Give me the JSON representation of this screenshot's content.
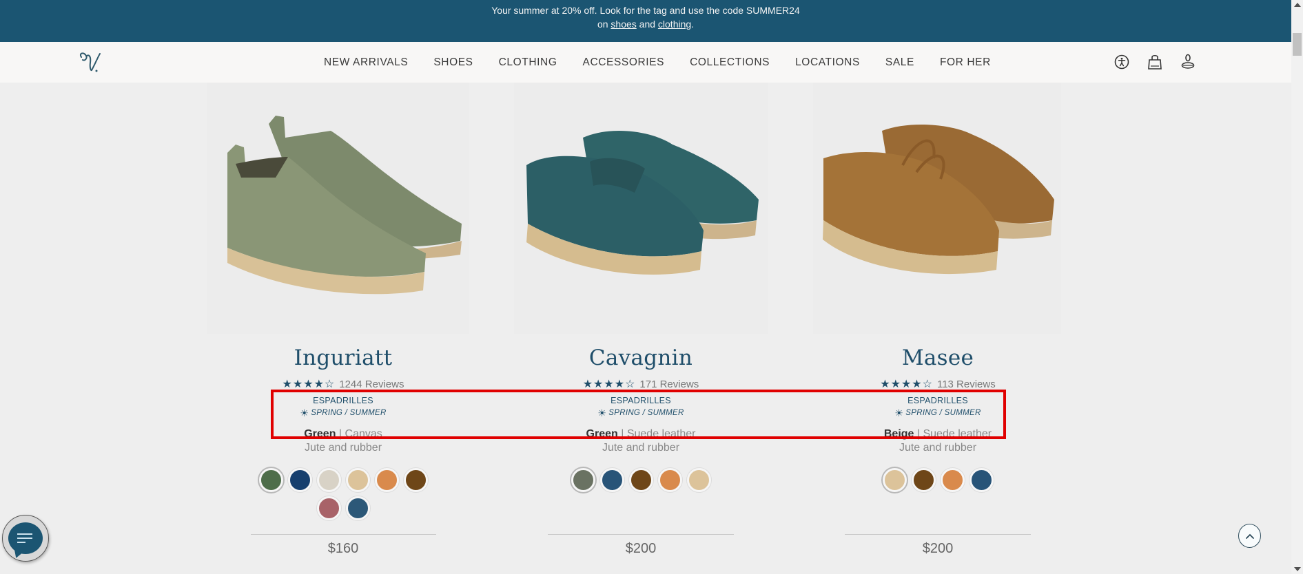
{
  "banner": {
    "line1": "Your summer at 20% off. Look for the tag and use the code SUMMER24",
    "line2_prefix": "on ",
    "link_shoes": "shoes",
    "line2_mid": " and ",
    "link_clothing": "clothing",
    "line2_suffix": "."
  },
  "header": {
    "logo_icon": "brand-monogram-logo",
    "nav": [
      {
        "label": "NEW ARRIVALS"
      },
      {
        "label": "SHOES"
      },
      {
        "label": "CLOTHING"
      },
      {
        "label": "ACCESSORIES"
      },
      {
        "label": "COLLECTIONS"
      },
      {
        "label": "LOCATIONS"
      },
      {
        "label": "SALE"
      },
      {
        "label": "FOR HER"
      }
    ],
    "icons": [
      "accessibility-icon",
      "shopping-bag-icon",
      "account-icon"
    ]
  },
  "products": [
    {
      "name": "Inguriatt",
      "stars": "★★★★☆",
      "rating": 4.5,
      "reviews": "1244 Reviews",
      "type": "ESPADRILLES",
      "season": "SPRING / SUMMER",
      "color": "Green",
      "material": "Canvas",
      "sole": "Jute and rubber",
      "swatches": [
        "#4e6e4a",
        "#163f6e",
        "#d8d2c6",
        "#dcc39a",
        "#d98a4c",
        "#6e4618",
        "#a86268",
        "#2c5878"
      ],
      "active_swatch": 0,
      "price": "$160"
    },
    {
      "name": "Cavagnin",
      "stars": "★★★★☆",
      "rating": 4.5,
      "reviews": "171 Reviews",
      "type": "ESPADRILLES",
      "season": "SPRING / SUMMER",
      "color": "Green",
      "material": "Suede leather",
      "sole": "Jute and rubber",
      "swatches": [
        "#6a7262",
        "#285478",
        "#6e4618",
        "#d98a4c",
        "#dcc39a"
      ],
      "active_swatch": 0,
      "price": "$200"
    },
    {
      "name": "Masee",
      "stars": "★★★★☆",
      "rating": 4.5,
      "reviews": "113 Reviews",
      "type": "ESPADRILLES",
      "season": "SPRING / SUMMER",
      "color": "Beige",
      "material": "Suede leather",
      "sole": "Jute and rubber",
      "swatches": [
        "#dcc39a",
        "#6e4618",
        "#d98a4c",
        "#285478"
      ],
      "active_swatch": 0,
      "price": "$200"
    }
  ],
  "colors": {
    "brand": "#1b5572",
    "highlight": "#e00000",
    "title": "#1f4e6a"
  }
}
